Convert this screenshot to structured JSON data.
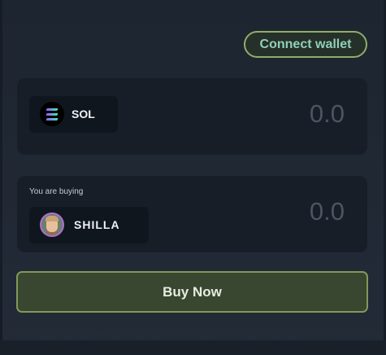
{
  "header": {
    "connect_label": "Connect wallet"
  },
  "pay": {
    "token_name": "SOL",
    "token_icon": "solana-logo-icon",
    "amount_placeholder": "0.0"
  },
  "buy": {
    "label": "You are buying",
    "token_name": "SHILLA",
    "token_icon": "shilla-avatar-icon",
    "amount_placeholder": "0.0"
  },
  "action": {
    "buy_label": "Buy Now"
  },
  "colors": {
    "accent_border": "#7f9a59",
    "button_bg": "#394630",
    "panel_bg": "#171e28",
    "page_bg": "#1f2733"
  }
}
